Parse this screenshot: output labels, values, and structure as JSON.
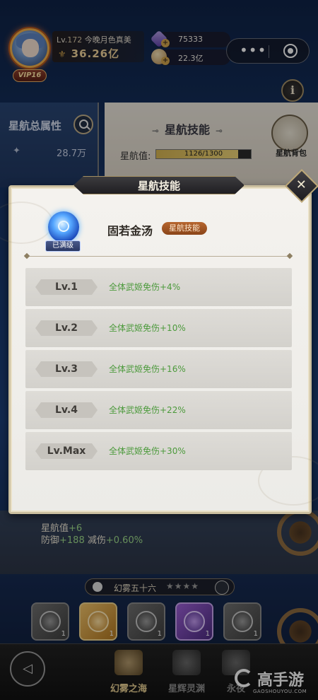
{
  "hud": {
    "level_prefix": "Lv.",
    "level": "172",
    "player_name": "今晚月色真美",
    "power": "36.26亿",
    "vip": "VIP16",
    "currency_gems": "75333",
    "currency_coins": "22.3亿"
  },
  "background": {
    "left_title": "星航总属性",
    "left_stat_value": "28.7万",
    "right_title": "星航技能",
    "star_value_label": "星航值:",
    "star_value_progress": "1126/1300",
    "star_value_current": 1126,
    "star_value_max": 1300,
    "bag_label": "星航背包",
    "bonus_line1_label": "星航值",
    "bonus_line1_value": "+6",
    "bonus_line2_def_label": "防御",
    "bonus_line2_def_value": "+188",
    "bonus_line2_red_label": "减伤",
    "bonus_line2_red_value": "+0.60%",
    "stage_name": "幻雾五十六",
    "stage_stars": "★★★★",
    "slot_counts": [
      "1",
      "1",
      "1",
      "1",
      "1"
    ]
  },
  "nav": {
    "items": [
      {
        "label": "幻雾之海",
        "active": true
      },
      {
        "label": "星辉灵渊",
        "active": false
      },
      {
        "label": "永夜",
        "active": false
      }
    ]
  },
  "watermark": {
    "brand": "高手游",
    "url": "GAOSHOUYOU.COM"
  },
  "modal": {
    "title": "星航技能",
    "maxed_label": "已满级",
    "skill_name": "固若金汤",
    "skill_tag": "星航技能",
    "levels": [
      {
        "level": "Lv.1",
        "effect": "全体武姬免伤+4%"
      },
      {
        "level": "Lv.2",
        "effect": "全体武姬免伤+10%"
      },
      {
        "level": "Lv.3",
        "effect": "全体武姬免伤+16%"
      },
      {
        "level": "Lv.4",
        "effect": "全体武姬免伤+22%"
      },
      {
        "level": "Lv.Max",
        "effect": "全体武姬免伤+30%"
      }
    ]
  },
  "colors": {
    "effect_green": "#4c9a3c",
    "skill_tag_brown": "#a3562a",
    "gold_accent": "#e8cf92"
  }
}
